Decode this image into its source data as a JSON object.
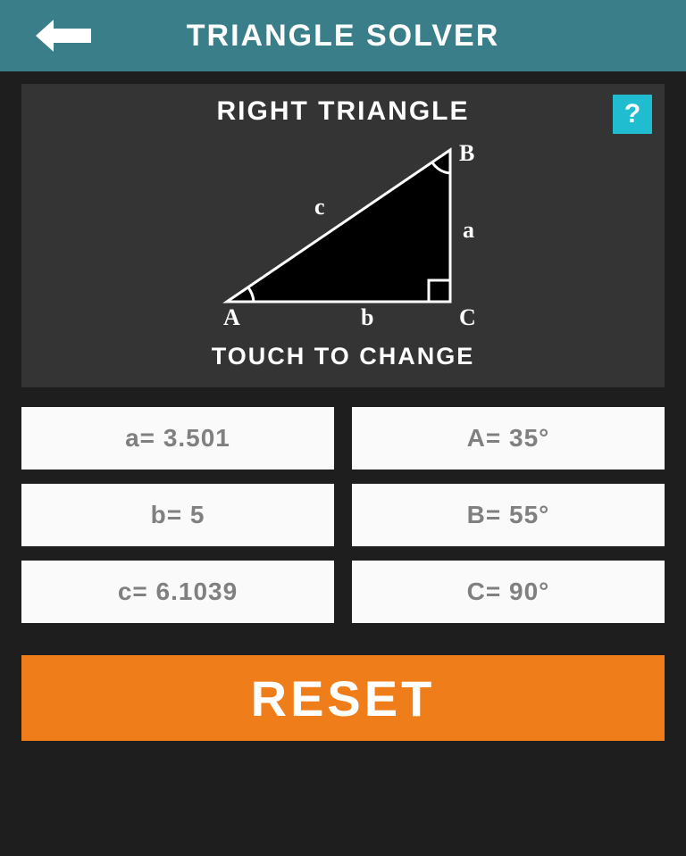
{
  "header": {
    "title": "TRIANGLE SOLVER"
  },
  "panel": {
    "title": "RIGHT TRIANGLE",
    "subtitle": "TOUCH TO CHANGE",
    "help_symbol": "?",
    "diagram": {
      "vertex_A": "A",
      "vertex_B": "B",
      "vertex_C": "C",
      "side_a": "a",
      "side_b": "b",
      "side_c": "c"
    }
  },
  "values": {
    "a": "a= 3.501",
    "A": "A= 35°",
    "b": "b= 5",
    "B": "B= 55°",
    "c": "c= 6.1039",
    "C": "C= 90°"
  },
  "reset": {
    "label": "RESET"
  }
}
